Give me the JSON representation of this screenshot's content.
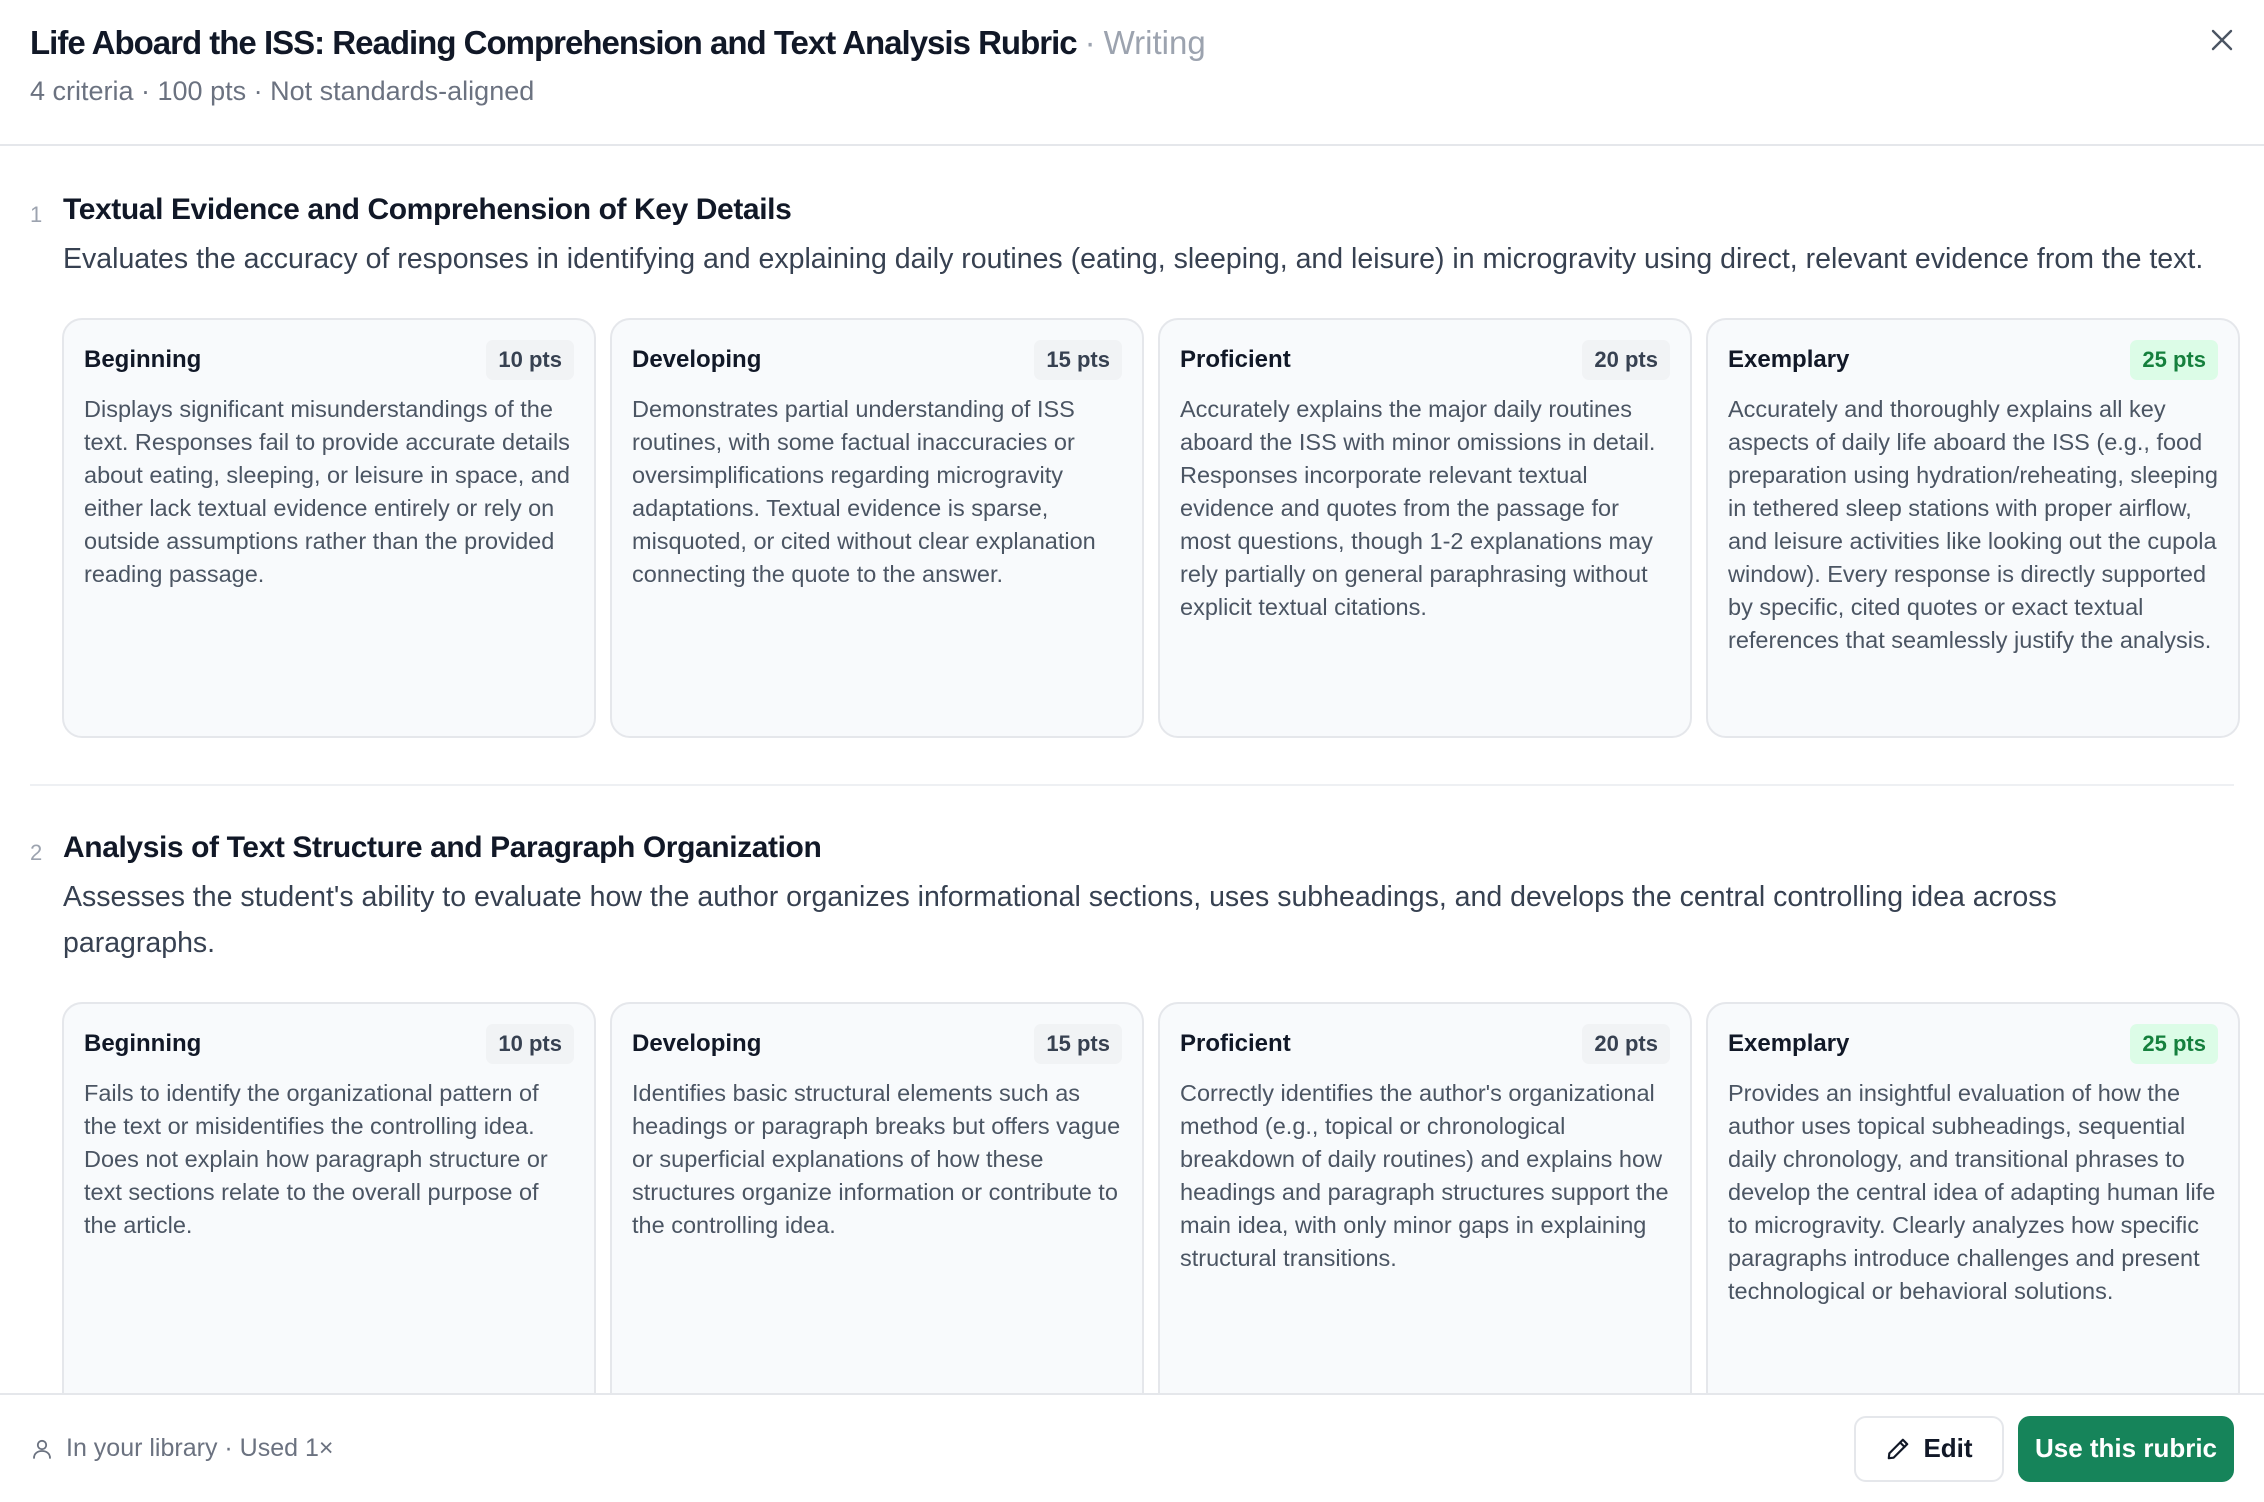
{
  "header": {
    "title": "Life Aboard the ISS: Reading Comprehension and Text Analysis Rubric",
    "separator": "·",
    "subject": "Writing",
    "meta": "4 criteria · 100 pts · Not standards-aligned",
    "close_icon": "close-icon"
  },
  "criteria": [
    {
      "number": "1",
      "title": "Textual Evidence and Comprehension of Key Details",
      "description": "Evaluates the accuracy of responses in identifying and explaining daily routines (eating, sleeping, and leisure) in microgravity using direct, relevant evidence from the text.",
      "levels": [
        {
          "name": "Beginning",
          "points": "10 pts",
          "text": "Displays significant misunderstandings of the text. Responses fail to provide accurate details about eating, sleeping, or leisure in space, and either lack textual evidence entirely or rely on outside assumptions rather than the provided reading passage."
        },
        {
          "name": "Developing",
          "points": "15 pts",
          "text": "Demonstrates partial understanding of ISS routines, with some factual inaccuracies or oversimplifications regarding microgravity adaptations. Textual evidence is sparse, misquoted, or cited without clear explanation connecting the quote to the answer."
        },
        {
          "name": "Proficient",
          "points": "20 pts",
          "text": "Accurately explains the major daily routines aboard the ISS with minor omissions in detail. Responses incorporate relevant textual evidence and quotes from the passage for most questions, though 1-2 explanations may rely partially on general paraphrasing without explicit textual citations."
        },
        {
          "name": "Exemplary",
          "points": "25 pts",
          "text": "Accurately and thoroughly explains all key aspects of daily life aboard the ISS (e.g., food preparation using hydration/reheating, sleeping in tethered sleep stations with proper airflow, and leisure activities like looking out the cupola window). Every response is directly supported by specific, cited quotes or exact textual references that seamlessly justify the analysis."
        }
      ]
    },
    {
      "number": "2",
      "title": "Analysis of Text Structure and Paragraph Organization",
      "description": "Assesses the student's ability to evaluate how the author organizes informational sections, uses subheadings, and develops the central controlling idea across paragraphs.",
      "levels": [
        {
          "name": "Beginning",
          "points": "10 pts",
          "text": "Fails to identify the organizational pattern of the text or misidentifies the controlling idea. Does not explain how paragraph structure or text sections relate to the overall purpose of the article."
        },
        {
          "name": "Developing",
          "points": "15 pts",
          "text": "Identifies basic structural elements such as headings or paragraph breaks but offers vague or superficial explanations of how these structures organize information or contribute to the controlling idea."
        },
        {
          "name": "Proficient",
          "points": "20 pts",
          "text": "Correctly identifies the author's organizational method (e.g., topical or chronological breakdown of daily routines) and explains how headings and paragraph structures support the main idea, with only minor gaps in explaining structural transitions."
        },
        {
          "name": "Exemplary",
          "points": "25 pts",
          "text": "Provides an insightful evaluation of how the author uses topical subheadings, sequential daily chronology, and transitional phrases to develop the central idea of adapting human life to microgravity. Clearly analyzes how specific paragraphs introduce challenges and present technological or behavioral solutions."
        }
      ]
    }
  ],
  "footer": {
    "user_icon": "user-icon",
    "library_status": "In your library · Used 1×",
    "edit_icon": "pencil-icon",
    "edit_label": "Edit",
    "use_label": "Use this rubric"
  },
  "colors": {
    "accent": "#16845a",
    "top_badge_bg": "#dcfce7",
    "top_badge_text": "#15803d"
  }
}
